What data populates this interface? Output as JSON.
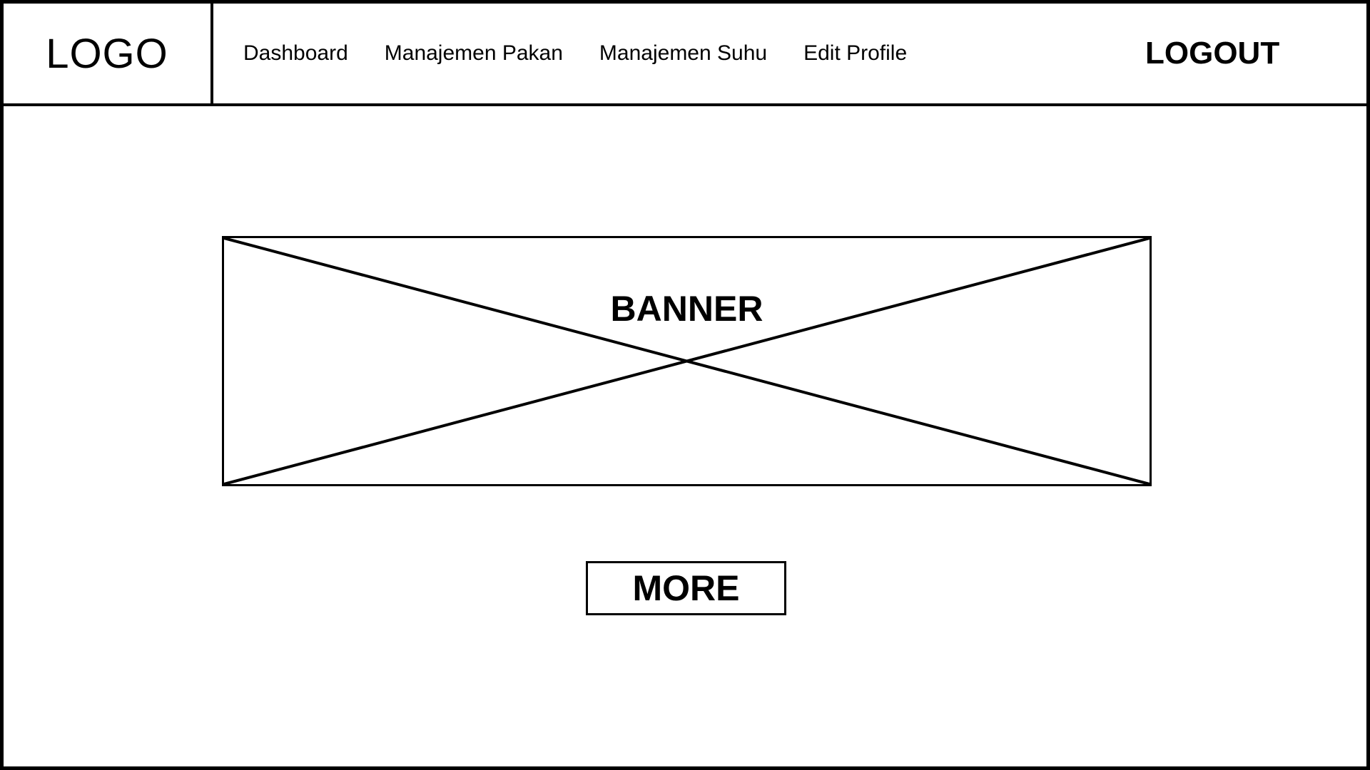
{
  "header": {
    "logo_text": "LOGO",
    "nav": [
      {
        "label": "Dashboard"
      },
      {
        "label": "Manajemen Pakan"
      },
      {
        "label": "Manajemen Suhu"
      },
      {
        "label": "Edit Profile"
      }
    ],
    "logout_label": "LOGOUT"
  },
  "main": {
    "banner_label": "BANNER",
    "more_label": "MORE"
  }
}
